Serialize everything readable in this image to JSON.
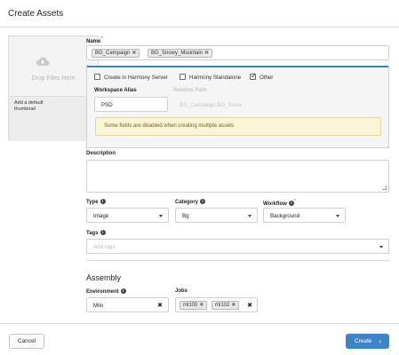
{
  "dialog": {
    "title": "Create Assets"
  },
  "thumbnail": {
    "drop_text": "Drop Files Here",
    "caption": "Add a default thumbnail",
    "icon": "cloud-upload-icon"
  },
  "name": {
    "label": "Name",
    "required": "*",
    "chips": [
      "BG_Campaign",
      "BG_Snowy_Mountain"
    ]
  },
  "location": {
    "options": [
      {
        "label": "Create in Harmony Server",
        "checked": false
      },
      {
        "label": "Harmony Standalone",
        "checked": false
      },
      {
        "label": "Other",
        "checked": true
      }
    ],
    "workspace_alias_label": "Workspace Alias",
    "workspace_alias_value": "PSD",
    "relative_path_label": "Relative Path",
    "relative_path_value": "BG_Campaign,BG_Snow",
    "note": "Some fields are disabled when creating multiple assets"
  },
  "description": {
    "label": "Description",
    "value": ""
  },
  "type": {
    "label": "Type",
    "value": "Image"
  },
  "category": {
    "label": "Category",
    "value": "Bg"
  },
  "workflow": {
    "label": "Workflow",
    "required": "*",
    "value": "Background"
  },
  "tags": {
    "label": "Tags",
    "placeholder": "Add tags"
  },
  "assembly": {
    "title": "Assembly",
    "environment_label": "Environment",
    "environment_value": "Milo",
    "jobs_label": "Jobs",
    "jobs": [
      "ml100",
      "ml102"
    ]
  },
  "footer": {
    "cancel_label": "Cancel",
    "create_label": "Create"
  },
  "colors": {
    "primary": "#3d85c6",
    "note_bg": "#fbf5d6",
    "panel_accent": "#3b82c4"
  }
}
